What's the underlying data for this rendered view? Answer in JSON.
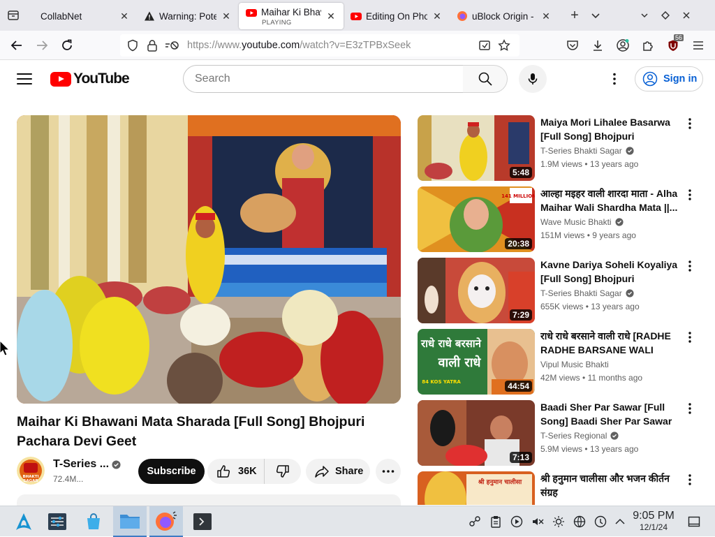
{
  "browser": {
    "tabs": [
      {
        "title": "CollabNet",
        "subtitle": "",
        "favicon": "none",
        "active": false
      },
      {
        "title": "Warning: Poter",
        "subtitle": "",
        "favicon": "warning-icon",
        "active": false
      },
      {
        "title": "Maihar Ki Bhav",
        "subtitle": "PLAYING",
        "favicon": "youtube-icon",
        "active": true
      },
      {
        "title": "Editing On Pho",
        "subtitle": "",
        "favicon": "youtube-icon",
        "active": false
      },
      {
        "title": "uBlock Origin -",
        "subtitle": "",
        "favicon": "firefox-icon",
        "active": false
      }
    ],
    "url_prefix": "https://www.",
    "url_domain": "youtube.com",
    "url_rest": "/watch?v=E3zTPBxSeek",
    "extension_badge": "56"
  },
  "youtube": {
    "logo_text": "YouTube",
    "search_placeholder": "Search",
    "sign_in_label": "Sign in",
    "video": {
      "title": "Maihar Ki Bhawani Mata Sharada [Full Song] Bhojpuri Pachara Devi Geet",
      "channel_name": "T-Series ...",
      "subscribers": "72.4M...",
      "subscribe_label": "Subscribe",
      "like_count": "36K",
      "share_label": "Share",
      "avatar_text_top": "BHAKTI",
      "avatar_text_bottom": "SAGAR"
    },
    "recommendations": [
      {
        "title": "Maiya Mori Lihalee Basarwa [Full Song] Bhojpuri Pachara...",
        "channel": "T-Series Bhakti Sagar",
        "verified": true,
        "views": "1.9M views",
        "age": "13 years ago",
        "duration": "5:48",
        "thumb_color": "#c8a24a"
      },
      {
        "title": "आल्हा मइहर वाली शारदा माता - Alha Maihar Wali Shardha Mata ||...",
        "channel": "Wave Music Bhakti",
        "verified": true,
        "views": "151M views",
        "age": "9 years ago",
        "duration": "20:38",
        "thumb_color": "#e0a020",
        "thumb_caption": "141 MILLION+"
      },
      {
        "title": "Kavne Dariya Soheli Koyaliya [Full Song] Bhojpuri Pachara...",
        "channel": "T-Series Bhakti Sagar",
        "verified": true,
        "views": "655K views",
        "age": "13 years ago",
        "duration": "7:29",
        "thumb_color": "#d64a3a"
      },
      {
        "title": "राधे राधे बरसाने वाली राधे [RADHE RADHE BARSANE WALI RADH...",
        "channel": "Vipul Music Bhakti",
        "verified": false,
        "views": "42M views",
        "age": "11 months ago",
        "duration": "44:54",
        "thumb_color": "#3c8a3c",
        "thumb_caption_1": "राधे राधे बरसाने",
        "thumb_caption_2": "वाली राधे",
        "thumb_caption_3": "84 KOS YATRA"
      },
      {
        "title": "Baadi Sher Par Sawar [Full Song] Baadi Sher Par Sawar",
        "channel": "T-Series Regional",
        "verified": true,
        "views": "5.9M views",
        "age": "13 years ago",
        "duration": "7:13",
        "thumb_color": "#8a4a2a"
      },
      {
        "title": "श्री हनुमान चालीसा और भजन कीर्तन संग्रह",
        "channel": "",
        "verified": false,
        "views": "",
        "age": "",
        "duration": "",
        "thumb_color": "#d06020",
        "thumb_caption": "श्री हनुमान चालीसा"
      }
    ]
  },
  "taskbar": {
    "time": "9:05 PM",
    "date": "12/1/24"
  },
  "colors": {
    "youtube_red": "#ff0000",
    "link_blue": "#065fd4",
    "taskbar_bg": "#e3e6ea"
  }
}
